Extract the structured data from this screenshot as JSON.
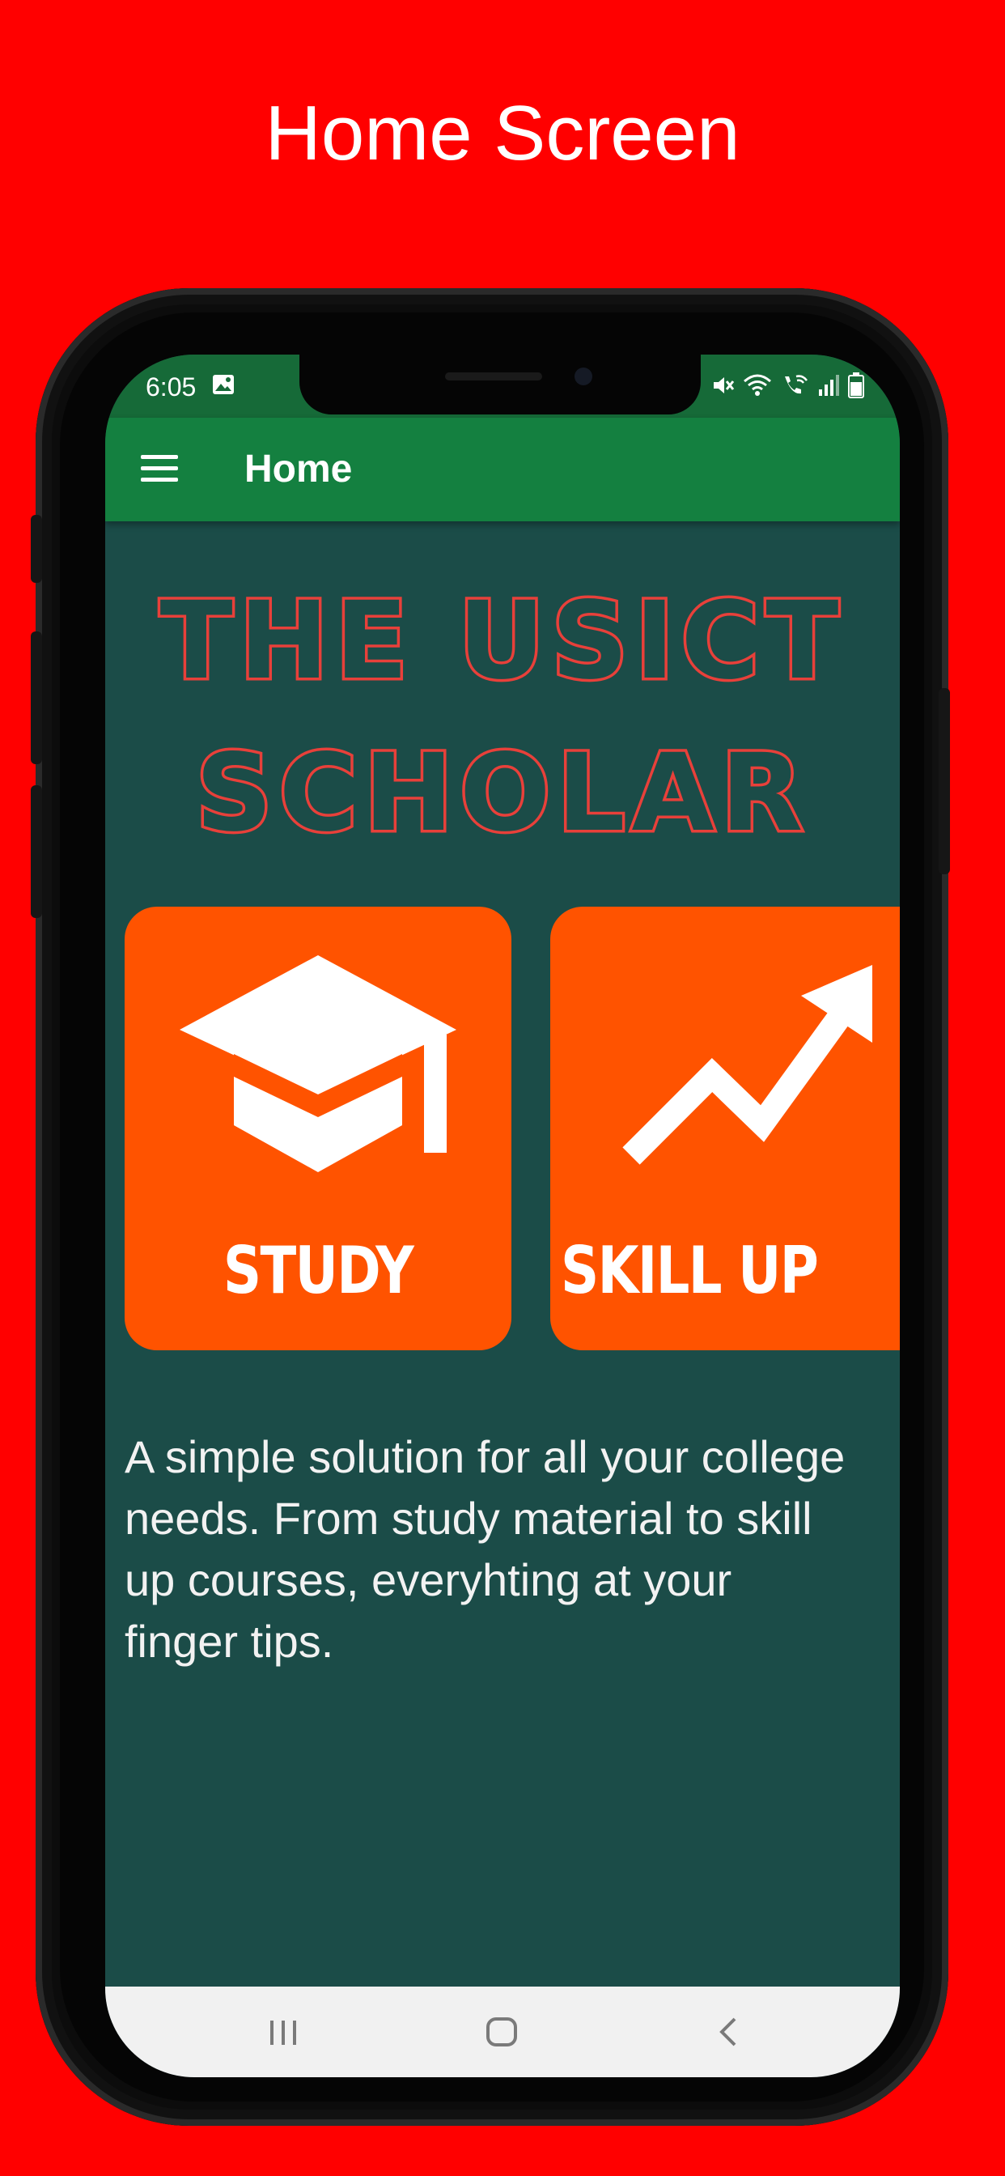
{
  "page": {
    "heading": "Home Screen",
    "background": "#ff0000"
  },
  "status_bar": {
    "time": "6:05",
    "icons": [
      "gallery-icon",
      "mute-icon",
      "wifi-icon",
      "wifi-call-icon",
      "signal-icon",
      "battery-icon"
    ]
  },
  "app_bar": {
    "menu_icon": "hamburger-menu-icon",
    "title": "Home",
    "color": "#148040"
  },
  "brand": {
    "line1": "THE USICT",
    "line2": "SCHOLAR",
    "color": "#e8403a"
  },
  "tiles": [
    {
      "label": "STUDY",
      "icon": "graduation-cap-icon",
      "color": "#ff5300"
    },
    {
      "label": "SKILL UP",
      "icon": "trending-up-arrow-icon",
      "color": "#ff5300"
    }
  ],
  "description": "A simple solution for all your college needs. From study material to skill up courses, everyhting at your finger tips.",
  "nav_bar": {
    "buttons": [
      "recents-icon",
      "home-icon",
      "back-icon"
    ]
  },
  "theme": {
    "screen_background": "#1b4c48"
  }
}
